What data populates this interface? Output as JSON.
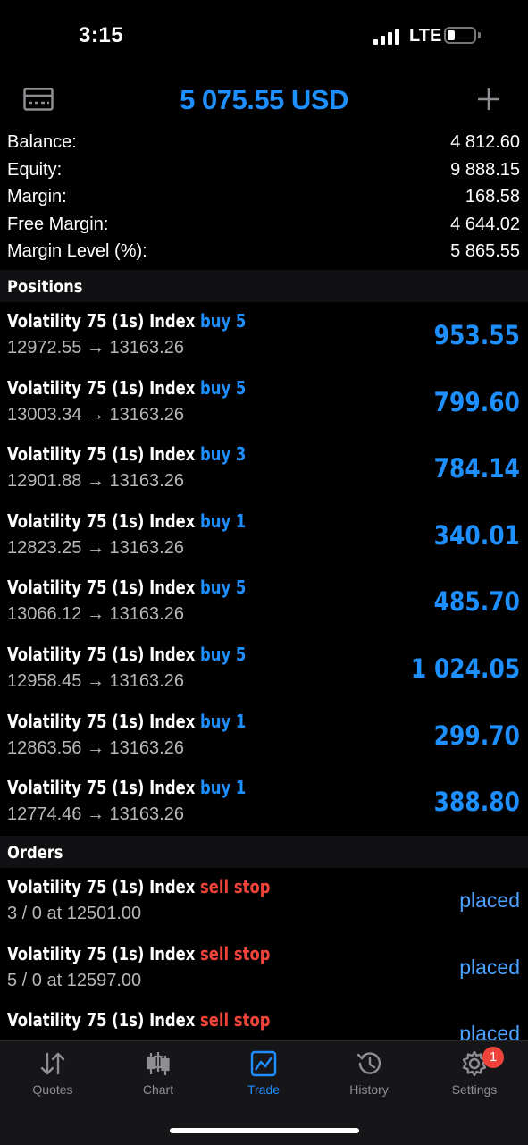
{
  "status_bar": {
    "time": "3:15",
    "network": "LTE",
    "battery_level": 0.2
  },
  "header": {
    "title": "5 075.55 USD"
  },
  "summary": [
    {
      "label": "Balance:",
      "value": "4 812.60"
    },
    {
      "label": "Equity:",
      "value": "9 888.15"
    },
    {
      "label": "Margin:",
      "value": "168.58"
    },
    {
      "label": "Free Margin:",
      "value": "4 644.02"
    },
    {
      "label": "Margin Level (%):",
      "value": "5 865.55"
    }
  ],
  "positions": {
    "header": "Positions",
    "items": [
      {
        "symbol": "Volatility 75 (1s) Index",
        "side": "buy 5",
        "prices": "12972.55 → 13163.26",
        "profit": "953.55"
      },
      {
        "symbol": "Volatility 75 (1s) Index",
        "side": "buy 5",
        "prices": "13003.34 → 13163.26",
        "profit": "799.60"
      },
      {
        "symbol": "Volatility 75 (1s) Index",
        "side": "buy 3",
        "prices": "12901.88 → 13163.26",
        "profit": "784.14"
      },
      {
        "symbol": "Volatility 75 (1s) Index",
        "side": "buy 1",
        "prices": "12823.25 → 13163.26",
        "profit": "340.01"
      },
      {
        "symbol": "Volatility 75 (1s) Index",
        "side": "buy 5",
        "prices": "13066.12 → 13163.26",
        "profit": "485.70"
      },
      {
        "symbol": "Volatility 75 (1s) Index",
        "side": "buy 5",
        "prices": "12958.45 → 13163.26",
        "profit": "1 024.05"
      },
      {
        "symbol": "Volatility 75 (1s) Index",
        "side": "buy 1",
        "prices": "12863.56 → 13163.26",
        "profit": "299.70"
      },
      {
        "symbol": "Volatility 75 (1s) Index",
        "side": "buy 1",
        "prices": "12774.46 → 13163.26",
        "profit": "388.80"
      }
    ]
  },
  "orders": {
    "header": "Orders",
    "items": [
      {
        "symbol": "Volatility 75 (1s) Index",
        "side": "sell stop",
        "details": "3 / 0 at 12501.00",
        "status": "placed"
      },
      {
        "symbol": "Volatility 75 (1s) Index",
        "side": "sell stop",
        "details": "5 / 0 at 12597.00",
        "status": "placed"
      },
      {
        "symbol": "Volatility 75 (1s) Index",
        "side": "sell stop",
        "details": "",
        "status": "placed"
      }
    ]
  },
  "tabs": [
    {
      "label": "Quotes",
      "icon": "quotes-icon",
      "active": false
    },
    {
      "label": "Chart",
      "icon": "chart-icon",
      "active": false
    },
    {
      "label": "Trade",
      "icon": "trade-icon",
      "active": true
    },
    {
      "label": "History",
      "icon": "history-icon",
      "active": false
    },
    {
      "label": "Settings",
      "icon": "gear-icon",
      "active": false,
      "badge": "1"
    }
  ],
  "colors": {
    "accent": "#1e8fff",
    "sell": "#f0433a",
    "background": "#000000"
  }
}
